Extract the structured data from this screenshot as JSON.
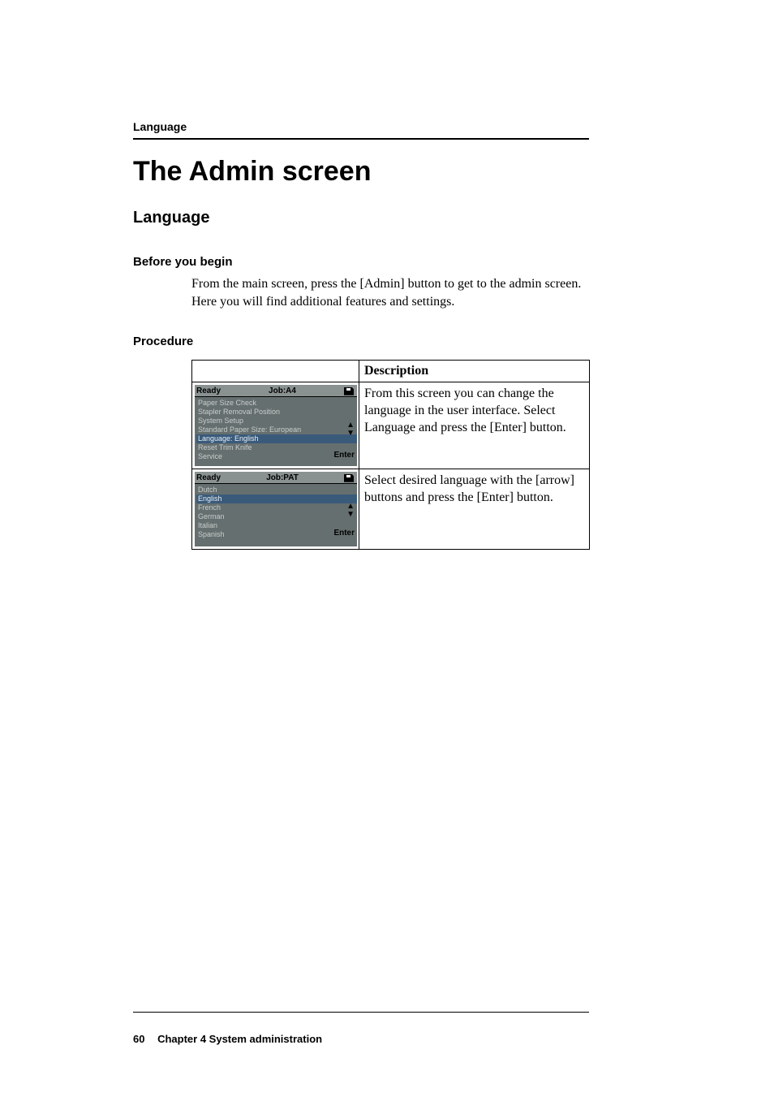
{
  "running_head": "Language",
  "title": "The Admin screen",
  "section": "Language",
  "before_heading": "Before you begin",
  "before_body": "From the main screen, press the [Admin] button to get to the admin screen. Here you will find additional features and settings.",
  "procedure_heading": "Procedure",
  "table": {
    "header_description": "Description",
    "rows": [
      {
        "lcd": {
          "ready": "Ready",
          "job": "Job:A4",
          "icon": "disk-icon",
          "lines": [
            "Paper Size Check",
            "Stapler Removal Position",
            "System Setup",
            "Standard Paper Size: European",
            "Language: English",
            "Reset Trim Knife",
            "Service"
          ],
          "selected_index": 4,
          "enter": "Enter"
        },
        "description": "From this screen you can change the language in the user interface. Select Language and press the [Enter] button."
      },
      {
        "lcd": {
          "ready": "Ready",
          "job": "Job:PAT",
          "icon": "disk-icon",
          "lines": [
            "Dutch",
            "English",
            "French",
            "German",
            "Italian",
            "Spanish"
          ],
          "selected_index": 1,
          "enter": "Enter"
        },
        "description": "Select desired language with the [arrow] buttons and press the [Enter] button."
      }
    ]
  },
  "footer": {
    "page_number": "60",
    "chapter": "Chapter 4 System administration"
  }
}
